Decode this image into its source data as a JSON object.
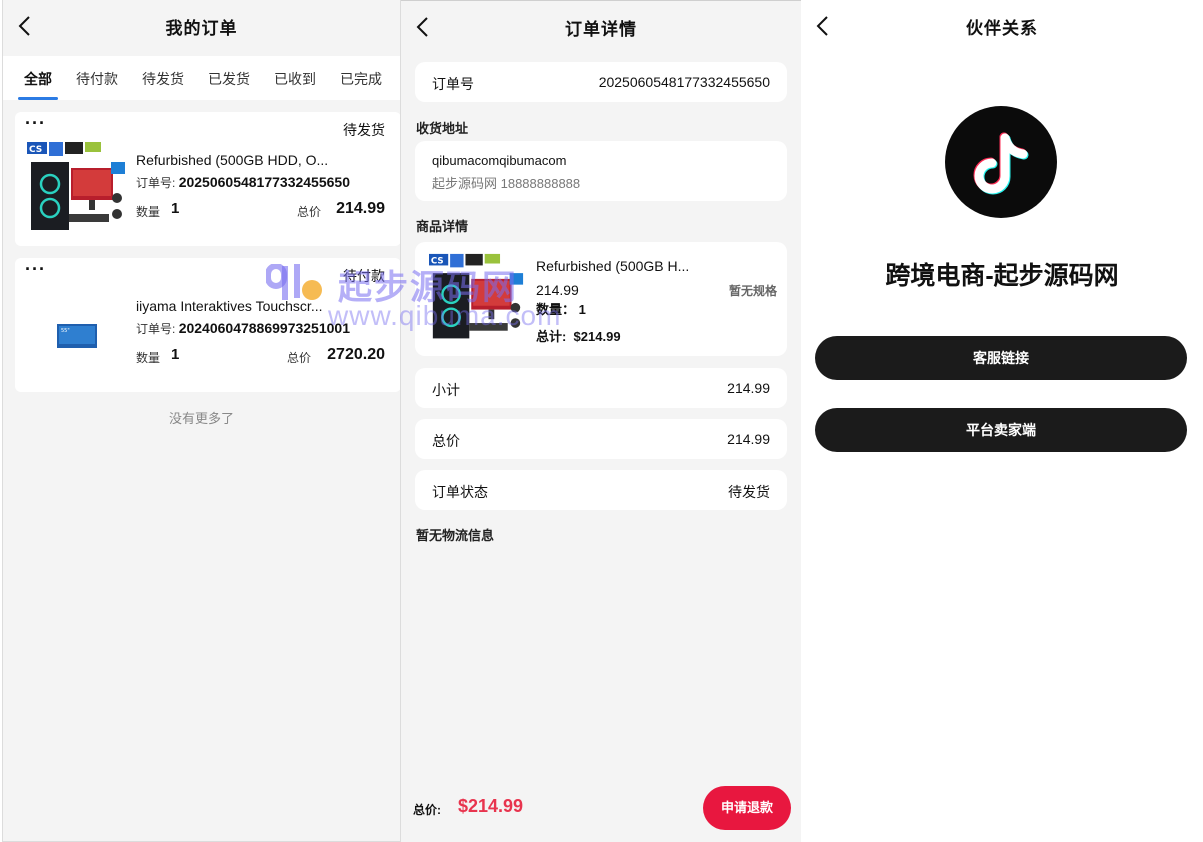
{
  "orders_screen": {
    "title": "我的订单",
    "tabs": [
      "全部",
      "待付款",
      "待发货",
      "已发货",
      "已收到",
      "已完成"
    ],
    "orders": [
      {
        "status": "待发货",
        "product_name": "Refurbished (500GB HDD, O...",
        "order_no_label": "订单号:",
        "order_no": "2025060548177332455650",
        "qty_label": "数量",
        "qty": "1",
        "total_label": "总价",
        "total": "214.99"
      },
      {
        "status": "待付款",
        "product_name": "iiyama Interaktives Touchscr...",
        "order_no_label": "订单号:",
        "order_no": "2024060478869973251001",
        "qty_label": "数量",
        "qty": "1",
        "total_label": "总价",
        "total": "2720.20"
      }
    ],
    "no_more": "没有更多了"
  },
  "detail_screen": {
    "title": "订单详情",
    "order_no_label": "订单号",
    "order_no": "2025060548177332455650",
    "address_section": "收货地址",
    "address_name": "qibumacomqibumacom",
    "address_sub": "起步源码网 18888888888",
    "goods_section": "商品详情",
    "goods": {
      "name": "Refurbished (500GB H...",
      "price": "214.99",
      "spec": "暂无规格",
      "qty": "数量： 1",
      "total": "总计:  $214.99"
    },
    "subtotal_label": "小计",
    "subtotal": "214.99",
    "total_label": "总价",
    "total": "214.99",
    "status_label": "订单状态",
    "status": "待发货",
    "logistics": "暂无物流信息",
    "bottom_total_label": "总价:",
    "bottom_total": "$214.99",
    "refund_button": "申请退款"
  },
  "partner_screen": {
    "title": "伙伴关系",
    "brand": "跨境电商-起步源码网",
    "service_button": "客服链接",
    "seller_button": "平台卖家端"
  },
  "watermark": {
    "text": "起步源码网",
    "url": "www.qibuma.com"
  },
  "colors": {
    "accent_blue": "#2b7be4",
    "refund_red": "#e8173f",
    "price_red": "#e8344e",
    "button_black": "#1b1b1b"
  }
}
